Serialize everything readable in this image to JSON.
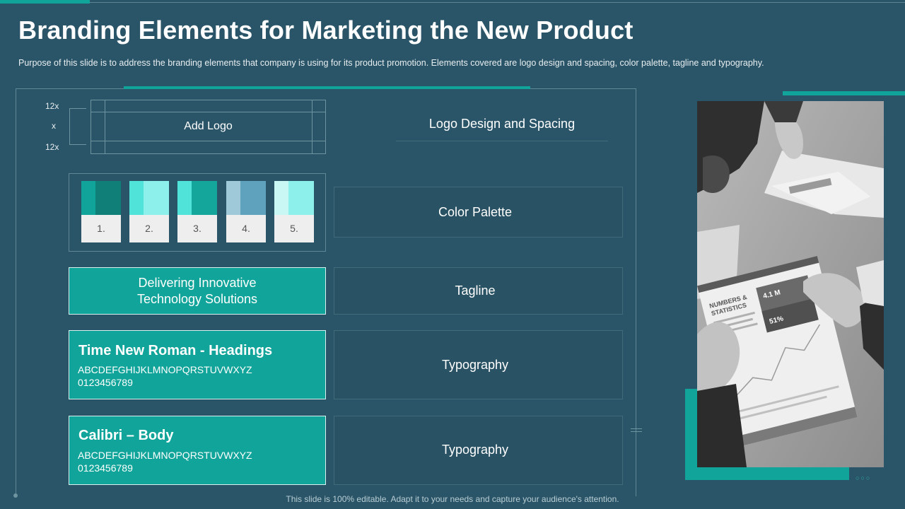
{
  "slide": {
    "title": "Branding Elements for Marketing the New Product",
    "subtitle": "Purpose of this slide is to address the branding elements that company is using for its product promotion. Elements covered are logo design and spacing, color palette, tagline and typography.",
    "footer": "This slide is 100% editable. Adapt it to your needs and capture your audience's attention."
  },
  "logo_section": {
    "dim_top": "12x",
    "dim_mid": "x",
    "dim_bottom": "12x",
    "placeholder": "Add Logo",
    "label": "Logo Design and Spacing"
  },
  "palette_section": {
    "label": "Color Palette",
    "swatches": [
      {
        "num": "1.",
        "light": "#11a49a",
        "dark": "#0f7f77"
      },
      {
        "num": "2.",
        "light": "#4fe3da",
        "dark": "#8ef0ea"
      },
      {
        "num": "3.",
        "light": "#4fe3da",
        "dark": "#14a59b"
      },
      {
        "num": "4.",
        "light": "#9fc9d8",
        "dark": "#5fa2be"
      },
      {
        "num": "5.",
        "light": "#c9f7f3",
        "dark": "#8ef0ea"
      }
    ]
  },
  "tagline_section": {
    "line1": "Delivering Innovative",
    "line2": "Technology Solutions",
    "label": "Tagline"
  },
  "typography_1": {
    "heading": "Time New Roman - Headings",
    "alphabet": "ABCDEFGHIJKLMNOPQRSTUVWXYZ",
    "digits": "0123456789",
    "label": "Typography"
  },
  "typography_2": {
    "heading": "Calibri – Body",
    "alphabet": "ABCDEFGHIJKLMNOPQRSTUVWXYZ",
    "digits": "0123456789",
    "label": "Typography"
  },
  "photo": {
    "doc_heading_1": "NUMBERS &",
    "doc_heading_2": "STATISTICS",
    "stat_1": "4.1 M",
    "stat_2": "51%"
  },
  "colors": {
    "background": "#2a5568",
    "accent": "#11a49a"
  }
}
